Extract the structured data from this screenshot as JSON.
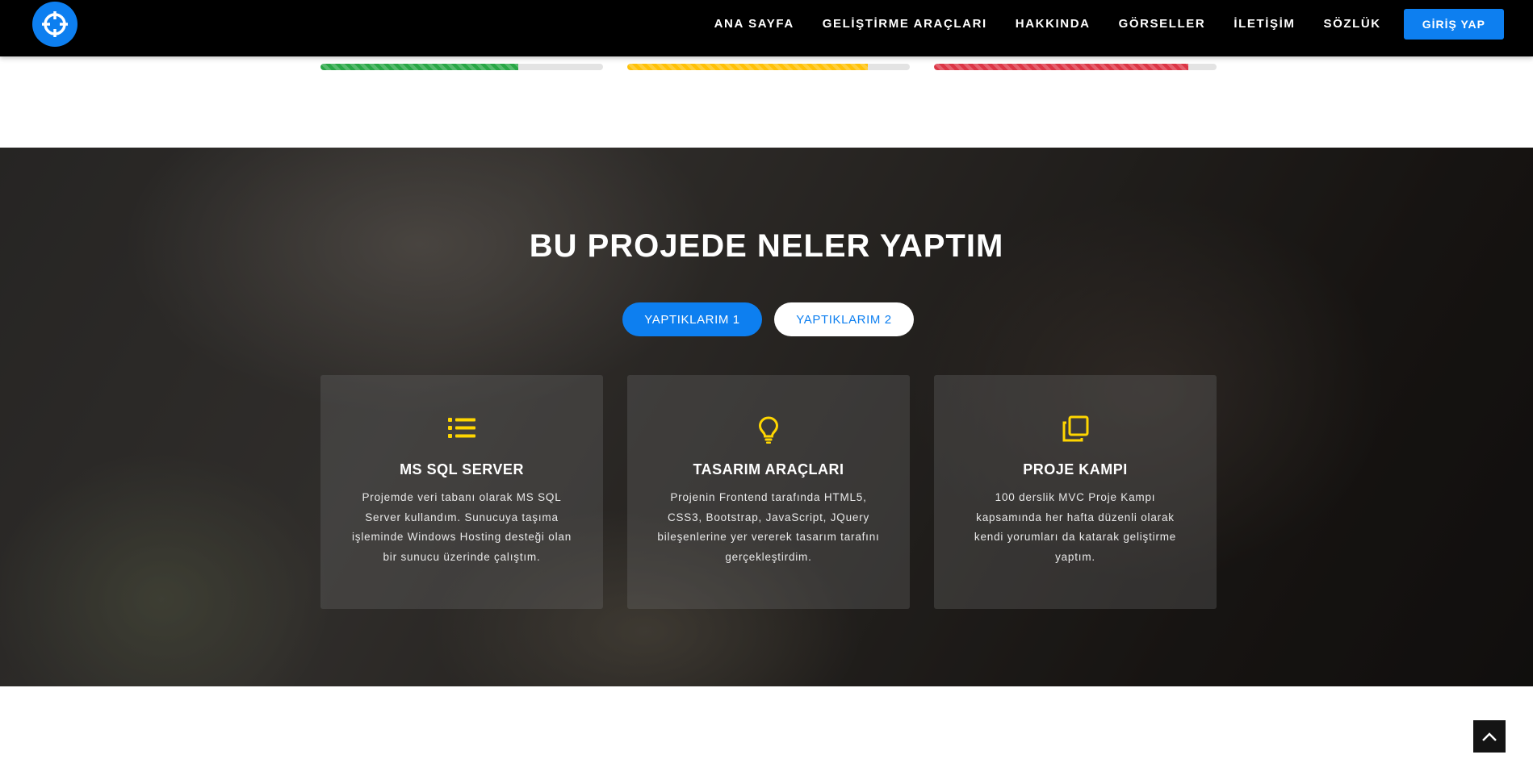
{
  "nav": {
    "logo_icon": "crosshair-icon",
    "items": [
      {
        "label": "ANA SAYFA"
      },
      {
        "label": "GELİŞTİRME ARAÇLARI"
      },
      {
        "label": "HAKKINDA"
      },
      {
        "label": "GÖRSELLER"
      },
      {
        "label": "İLETİŞİM"
      },
      {
        "label": "SÖZLÜK"
      }
    ],
    "login_label": "GİRİŞ YAP"
  },
  "progress_bars": [
    {
      "percent": 70,
      "color": "#28a745"
    },
    {
      "percent": 85,
      "color": "#ffc107"
    },
    {
      "percent": 90,
      "color": "#dc3545"
    }
  ],
  "section": {
    "title": "BU PROJEDE NELER YAPTIM",
    "tabs": [
      {
        "label": "YAPTIKLARIM 1",
        "active": true
      },
      {
        "label": "YAPTIKLARIM 2",
        "active": false
      }
    ],
    "cards": [
      {
        "icon": "list-icon",
        "title": "MS SQL SERVER",
        "text": "Projemde veri tabanı olarak MS SQL Server kullandım. Sunucuya taşıma işleminde Windows Hosting desteği olan bir sunucu üzerinde çalıştım."
      },
      {
        "icon": "lightbulb-icon",
        "title": "TASARIM ARAÇLARI",
        "text": "Projenin Frontend tarafında HTML5, CSS3, Bootstrap, JavaScript, JQuery bileşenlerine yer vererek tasarım tarafını gerçekleştirdim."
      },
      {
        "icon": "copy-icon",
        "title": "PROJE KAMPI",
        "text": "100 derslik MVC Proje Kampı kapsamında her hafta düzenli olarak kendi yorumları da katarak geliştirme yaptım."
      }
    ]
  },
  "colors": {
    "accent": "#0d7ff0",
    "icon_yellow": "#ffd600"
  },
  "back_to_top_icon": "chevron-up-icon"
}
